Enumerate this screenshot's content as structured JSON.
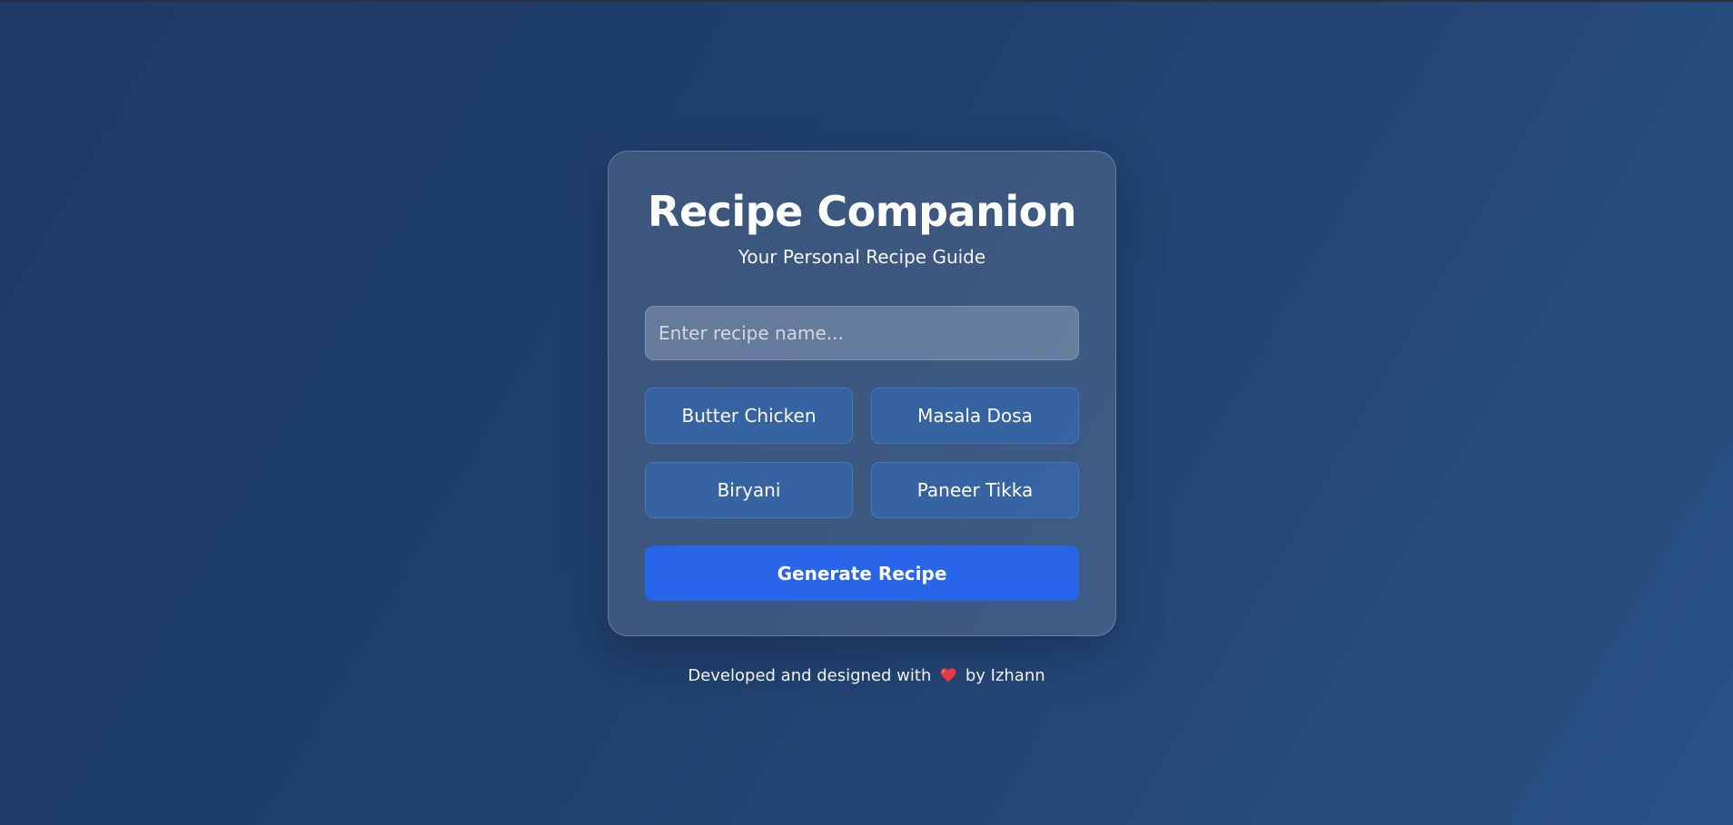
{
  "app": {
    "title": "Recipe Companion",
    "subtitle": "Your Personal Recipe Guide"
  },
  "search": {
    "value": "",
    "placeholder": "Enter recipe name..."
  },
  "suggestions": [
    {
      "label": "Butter Chicken"
    },
    {
      "label": "Masala Dosa"
    },
    {
      "label": "Biryani"
    },
    {
      "label": "Paneer Tikka"
    }
  ],
  "actions": {
    "generate_label": "Generate Recipe"
  },
  "footer": {
    "prefix": "Developed and designed with",
    "icon": "heart-icon",
    "suffix": "by Izhann"
  },
  "colors": {
    "primary_button": "#2865e8",
    "heart": "#e53948"
  }
}
